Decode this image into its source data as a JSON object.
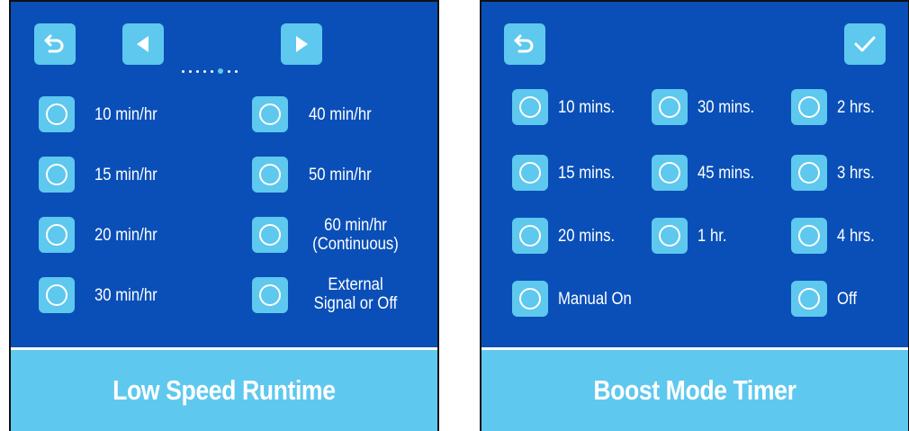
{
  "left_screen": {
    "title": "Low Speed Runtime",
    "pager": {
      "count": 8,
      "active_index": 5
    },
    "options": [
      {
        "label": "10 min/hr",
        "selected": false
      },
      {
        "label": "15 min/hr",
        "selected": false
      },
      {
        "label": "20 min/hr",
        "selected": false
      },
      {
        "label": "30 min/hr",
        "selected": false
      },
      {
        "label": "40 min/hr",
        "selected": false
      },
      {
        "label": "50 min/hr",
        "selected": false
      },
      {
        "label_line1": "60 min/hr",
        "label_line2": "(Continuous)",
        "selected": false
      },
      {
        "label_line1": "External",
        "label_line2": "Signal or Off",
        "selected": false
      }
    ]
  },
  "right_screen": {
    "title": "Boost Mode Timer",
    "options": [
      {
        "label": "10 mins.",
        "selected": false
      },
      {
        "label": "30 mins.",
        "selected": false
      },
      {
        "label": "2 hrs.",
        "selected": false
      },
      {
        "label": "15 mins.",
        "selected": false
      },
      {
        "label": "45 mins.",
        "selected": false
      },
      {
        "label": "3 hrs.",
        "selected": false
      },
      {
        "label": "20 mins.",
        "selected": false
      },
      {
        "label": "1 hr.",
        "selected": false
      },
      {
        "label": "4 hrs.",
        "selected": false
      },
      {
        "label": "Manual On",
        "selected": false
      },
      {
        "label": "Off",
        "selected": false
      }
    ]
  },
  "icons": {
    "back": "back-arrow-icon",
    "prev": "triangle-left-icon",
    "next": "triangle-right-icon",
    "confirm": "checkmark-icon",
    "radio": "radio-circle-icon"
  },
  "colors": {
    "panel_blue": "#0a4fb8",
    "accent_light_blue": "#5ec8ee",
    "text": "#ffffff"
  }
}
